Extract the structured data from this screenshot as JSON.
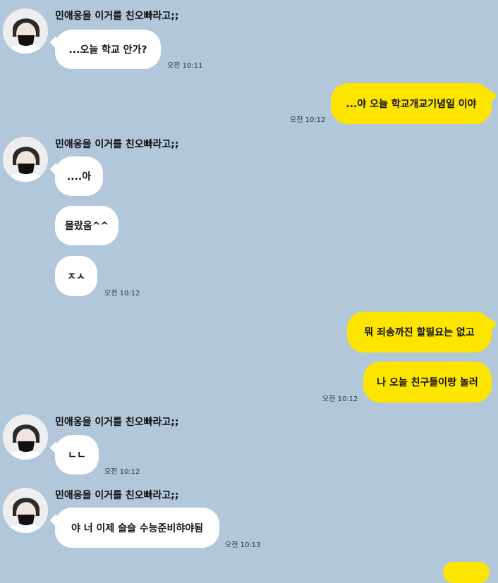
{
  "colors": {
    "background": "#b2c7da",
    "incoming_bubble": "#ffffff",
    "outgoing_bubble": "#fee500"
  },
  "contact": {
    "name": "민애옹을 이거를 친오빠라고;;"
  },
  "messages": [
    {
      "text": "...오늘 학교 안가?",
      "time": "오전 10:11"
    },
    {
      "text": "...야 오늘 학교개교기념일 이야",
      "time": "오전 10:12"
    },
    {
      "text": "....아"
    },
    {
      "text": "몰랐음^^"
    },
    {
      "text": "ㅈㅅ",
      "time": "오전 10:12"
    },
    {
      "text": "뭐 죄송까진 할필요는 없고"
    },
    {
      "text": "나 오늘 친구들이랑 놀러",
      "time": "오전 10:12"
    },
    {
      "text": "ㄴㄴ",
      "time": "오전 10:12"
    },
    {
      "text": "야 너 이제 슬슬 수능준비햐야됨",
      "time": "오전 10:13"
    }
  ]
}
